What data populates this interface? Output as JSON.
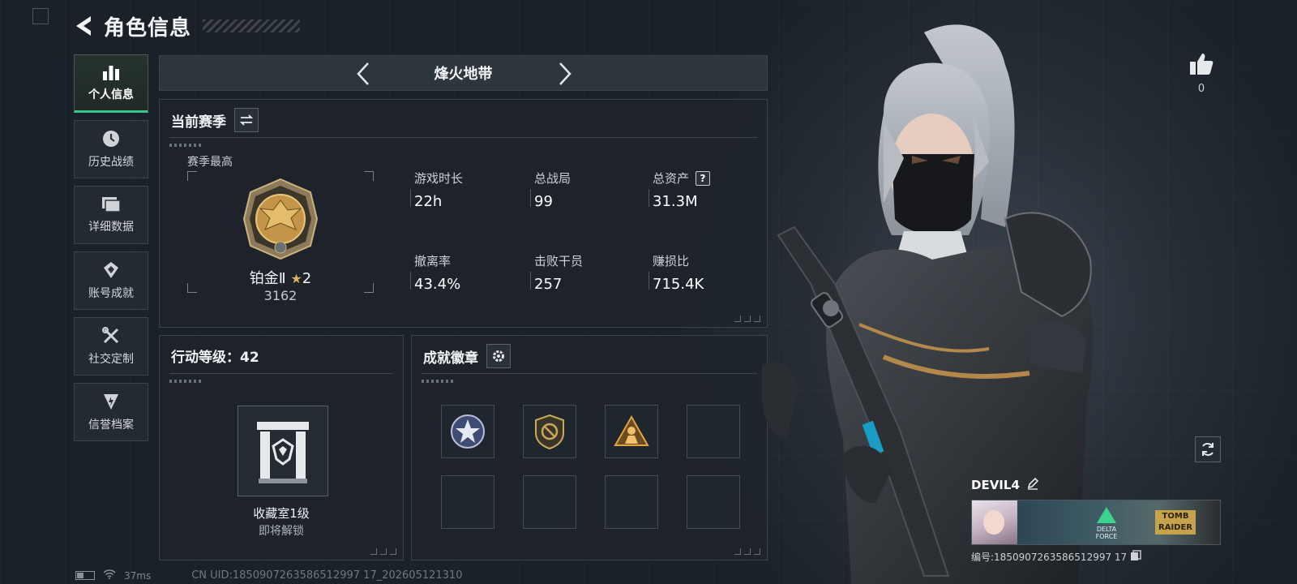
{
  "header": {
    "title": "角色信息"
  },
  "nav": [
    {
      "label": "个人信息",
      "icon": "bar-chart-icon",
      "active": true
    },
    {
      "label": "历史战绩",
      "icon": "clock-icon"
    },
    {
      "label": "详细数据",
      "icon": "folder-icon"
    },
    {
      "label": "账号成就",
      "icon": "diamond-badge-icon"
    },
    {
      "label": "社交定制",
      "icon": "wrench-icon"
    },
    {
      "label": "信誉档案",
      "icon": "shield-bolt-icon"
    }
  ],
  "mode": {
    "name": "烽火地带"
  },
  "season": {
    "title": "当前赛季",
    "best_label": "赛季最高",
    "rank": {
      "tier": "铂金Ⅱ",
      "stars": "2",
      "score": "3162"
    },
    "stats": [
      {
        "label": "游戏时长",
        "value": "22h"
      },
      {
        "label": "总战局",
        "value": "99"
      },
      {
        "label": "总资产",
        "value": "31.3M",
        "help": "?"
      },
      {
        "label": "撤离率",
        "value": "43.4%"
      },
      {
        "label": "击败干员",
        "value": "257"
      },
      {
        "label": "赚损比",
        "value": "715.4K"
      }
    ]
  },
  "level": {
    "title": "行动等级：42",
    "vault_name": "收藏室1级",
    "vault_status": "即将解锁"
  },
  "badges": {
    "title": "成就徽章",
    "slots": [
      "star-emblem-badge",
      "compass-shield-badge",
      "triangle-operator-badge",
      "",
      "",
      "",
      "",
      ""
    ]
  },
  "like": {
    "count": "0"
  },
  "player": {
    "name": "DEVIL4",
    "banner_logo": "DELTA FORCE",
    "banner_tag": "TOMB RAIDER",
    "id_text": "编号:1850907263586512997 17"
  },
  "status": {
    "ping": "37ms",
    "uid": "CN UID:1850907263586512997 17_202605121310"
  },
  "colors": {
    "accent": "#36c58a",
    "gold": "#d9b25a",
    "panel": "#1e242b"
  }
}
